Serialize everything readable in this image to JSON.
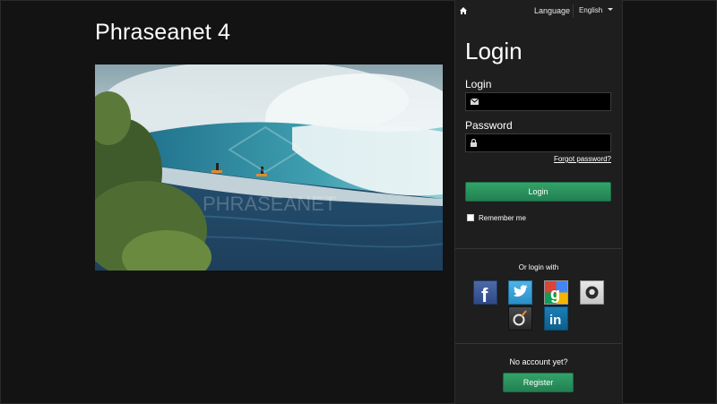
{
  "app": {
    "title": "Phraseanet 4"
  },
  "hero": {
    "watermark": "PHRASEANET"
  },
  "topbar": {
    "language_label": "Language",
    "language_selected": "English"
  },
  "login": {
    "heading": "Login",
    "login_label": "Login",
    "login_value": "",
    "password_label": "Password",
    "password_value": "",
    "forgot_password": "Forgot password?",
    "submit_label": "Login",
    "remember_me": "Remember me"
  },
  "social": {
    "heading": "Or login with",
    "providers": [
      "facebook",
      "twitter",
      "google",
      "github",
      "viadeo",
      "linkedin"
    ]
  },
  "register": {
    "prompt": "No account yet?",
    "button_label": "Register"
  },
  "colors": {
    "accent": "#2a9160",
    "panel": "#1e1e1e",
    "background": "#131313"
  }
}
